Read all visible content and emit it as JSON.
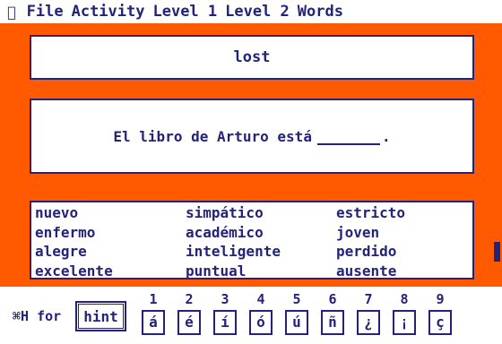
{
  "menu": {
    "apple_icon": "apple-icon",
    "items": [
      "File",
      "Activity",
      "Level 1",
      "Level 2",
      "Words"
    ]
  },
  "answer_box": {
    "text": "lost"
  },
  "sentence": {
    "before_blank": "El libro de Arturo está",
    "after_blank": "."
  },
  "word_bank": {
    "words": [
      "nuevo",
      "simpático",
      "estricto",
      "enfermo",
      "académico",
      "joven",
      "alegre",
      "inteligente",
      "perdido",
      "excelente",
      "puntual",
      "ausente"
    ]
  },
  "bottom": {
    "hint_prefix": "⌘H for",
    "hint_button": "hint",
    "keys": [
      {
        "num": "1",
        "char": "á"
      },
      {
        "num": "2",
        "char": "é"
      },
      {
        "num": "3",
        "char": "í"
      },
      {
        "num": "4",
        "char": "ó"
      },
      {
        "num": "5",
        "char": "ú"
      },
      {
        "num": "6",
        "char": "ñ"
      },
      {
        "num": "7",
        "char": "¿"
      },
      {
        "num": "8",
        "char": "¡"
      },
      {
        "num": "9",
        "char": "ç"
      }
    ]
  },
  "colors": {
    "background": "#ff5a00",
    "ink": "#24237a",
    "panel": "#ffffff"
  }
}
